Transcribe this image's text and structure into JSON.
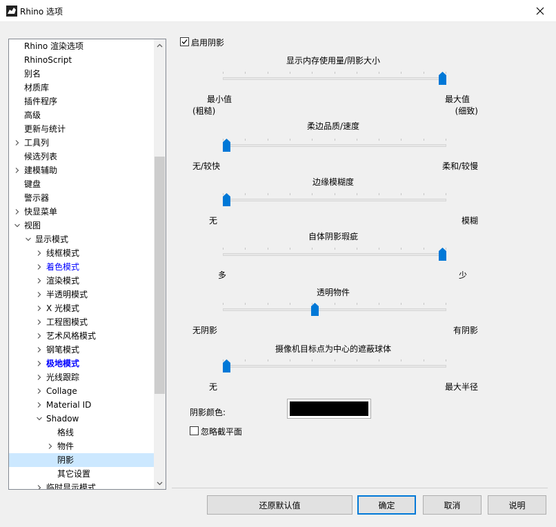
{
  "window": {
    "title": "Rhino 选项",
    "icon": "rhino-app-icon"
  },
  "tree": {
    "items": [
      {
        "label": "Rhino 渲染选项",
        "level": 0,
        "chevron": "none"
      },
      {
        "label": "RhinoScript",
        "level": 0,
        "chevron": "none"
      },
      {
        "label": "别名",
        "level": 0,
        "chevron": "none"
      },
      {
        "label": "材质库",
        "level": 0,
        "chevron": "none"
      },
      {
        "label": "插件程序",
        "level": 0,
        "chevron": "none"
      },
      {
        "label": "高级",
        "level": 0,
        "chevron": "none"
      },
      {
        "label": "更新与统计",
        "level": 0,
        "chevron": "none"
      },
      {
        "label": "工具列",
        "level": 0,
        "chevron": "right"
      },
      {
        "label": "候选列表",
        "level": 0,
        "chevron": "none"
      },
      {
        "label": "建模辅助",
        "level": 0,
        "chevron": "right"
      },
      {
        "label": "键盘",
        "level": 0,
        "chevron": "none"
      },
      {
        "label": "警示器",
        "level": 0,
        "chevron": "none"
      },
      {
        "label": "快显菜单",
        "level": 0,
        "chevron": "right"
      },
      {
        "label": "视图",
        "level": 0,
        "chevron": "down"
      },
      {
        "label": "显示模式",
        "level": 1,
        "chevron": "down"
      },
      {
        "label": "线框模式",
        "level": 2,
        "chevron": "right"
      },
      {
        "label": "着色模式",
        "level": 2,
        "chevron": "right",
        "color": "#0000ff"
      },
      {
        "label": "渲染模式",
        "level": 2,
        "chevron": "right"
      },
      {
        "label": "半透明模式",
        "level": 2,
        "chevron": "right"
      },
      {
        "label": "X 光模式",
        "level": 2,
        "chevron": "right"
      },
      {
        "label": "工程图模式",
        "level": 2,
        "chevron": "right"
      },
      {
        "label": "艺术风格模式",
        "level": 2,
        "chevron": "right"
      },
      {
        "label": "钢笔模式",
        "level": 2,
        "chevron": "right"
      },
      {
        "label": "极地模式",
        "level": 2,
        "chevron": "right",
        "color": "#0000ff",
        "bold": true
      },
      {
        "label": "光线跟踪",
        "level": 2,
        "chevron": "right"
      },
      {
        "label": "Collage",
        "level": 2,
        "chevron": "right"
      },
      {
        "label": "Material ID",
        "level": 2,
        "chevron": "right"
      },
      {
        "label": "Shadow",
        "level": 2,
        "chevron": "down"
      },
      {
        "label": "格线",
        "level": 3,
        "chevron": "none"
      },
      {
        "label": "物件",
        "level": 3,
        "chevron": "right"
      },
      {
        "label": "阴影",
        "level": 3,
        "chevron": "none",
        "selected": true
      },
      {
        "label": "其它设置",
        "level": 3,
        "chevron": "none"
      },
      {
        "label": "临时显示模式",
        "level": 2,
        "chevron": "right"
      }
    ]
  },
  "enable_shadows": {
    "label": "启用阴影",
    "checked": true
  },
  "sliders": [
    {
      "title": "显示内存使用量/阴影大小",
      "value": 1.0,
      "min_label": "最小值",
      "min_sub": "(粗糙)",
      "max_label": "最大值",
      "max_sub": "(细致)"
    },
    {
      "title": "柔边品质/速度",
      "value": 0.0,
      "min_label": "无/较快",
      "max_label": "柔和/较慢"
    },
    {
      "title": "边缘模糊度",
      "value": 0.0,
      "min_label": "无",
      "max_label": "模糊"
    },
    {
      "title": "自体阴影瑕疵",
      "value": 1.0,
      "min_label": "多",
      "max_label": "少"
    },
    {
      "title": "透明物件",
      "value": 0.41,
      "min_label": "无阴影",
      "max_label": "有阴影"
    },
    {
      "title": "摄像机目标点为中心的遮蔽球体",
      "value": 0.0,
      "min_label": "无",
      "max_label": "最大半径"
    }
  ],
  "shadow_color": {
    "label": "阴影颜色:",
    "value": "#000000"
  },
  "ignore_clipping": {
    "label": "忽略截平面",
    "checked": false
  },
  "buttons": {
    "restore": "还原默认值",
    "ok": "确定",
    "cancel": "取消",
    "help": "说明"
  }
}
